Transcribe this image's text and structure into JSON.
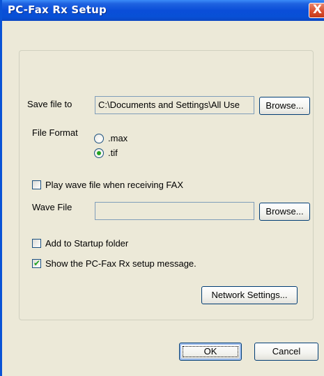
{
  "window": {
    "title": "PC-Fax Rx Setup",
    "close_glyph": "X",
    "colors": {
      "titlebar": "#0A4ED8",
      "dialog_bg": "#ECE9D8",
      "check_green": "#21A121"
    }
  },
  "save_file": {
    "label": "Save file to",
    "value": "C:\\Documents and Settings\\All Use",
    "browse_label": "Browse..."
  },
  "file_format": {
    "label": "File Format",
    "options": [
      {
        "label": ".max",
        "selected": false
      },
      {
        "label": ".tif",
        "selected": true
      }
    ]
  },
  "play_wave": {
    "label": "Play wave file when receiving FAX",
    "checked": false
  },
  "wave_file": {
    "label": "Wave File",
    "value": "",
    "browse_label": "Browse..."
  },
  "add_startup": {
    "label": "Add to Startup folder",
    "checked": false
  },
  "show_message": {
    "label": "Show the PC-Fax Rx setup message.",
    "checked": true,
    "check_glyph": "✔"
  },
  "network_settings_label": "Network Settings...",
  "ok_label": "OK",
  "cancel_label": "Cancel"
}
